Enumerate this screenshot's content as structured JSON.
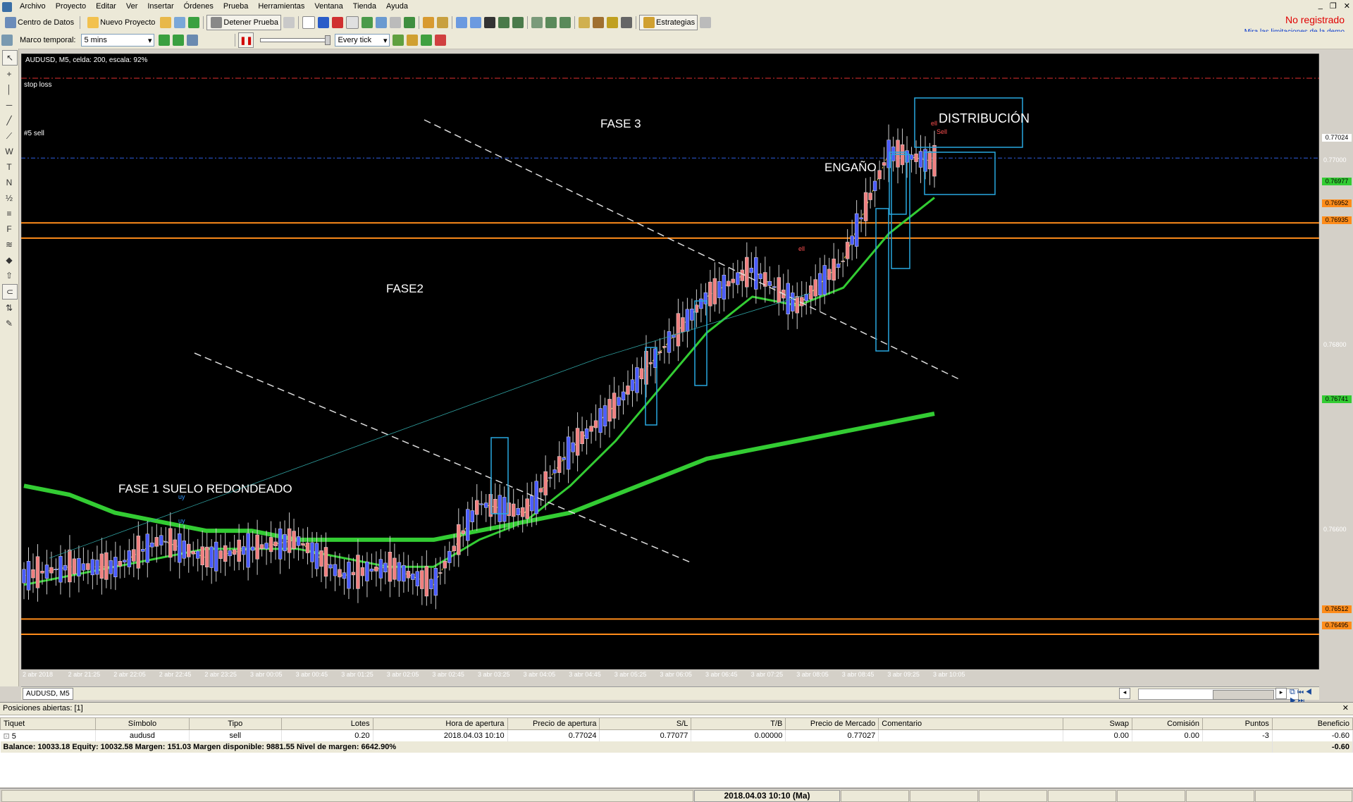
{
  "menu": [
    "Archivo",
    "Proyecto",
    "Editar",
    "Ver",
    "Insertar",
    "Órdenes",
    "Prueba",
    "Herramientas",
    "Ventana",
    "Tienda",
    "Ayuda"
  ],
  "toolbar": {
    "data_center": "Centro de Datos",
    "new_project": "Nuevo Proyecto",
    "stop_test": "Detener Prueba",
    "strategies": "Estrategias",
    "not_registered": "No registrado",
    "demo_limits": "Mira las limitaciones de la demo",
    "timeframe_label": "Marco temporal:",
    "timeframe_value": "5 mins",
    "tick_mode": "Every tick"
  },
  "chart": {
    "header": "AUDUSD, M5, celda: 200, escala: 92%",
    "stop_loss_label": "stop loss",
    "sell_line_label": "#5 sell",
    "annotations": {
      "fase1": "FASE 1 SUELO REDONDEADO",
      "fase2": "FASE2",
      "fase3": "FASE 3",
      "engano": "ENGAÑO",
      "distribucion": "DISTRIBUCIÓN"
    },
    "trade_labels": {
      "buy1": "uy",
      "buy2": "uy",
      "sell1": "ell",
      "sell2": "ell",
      "sell3": "Sell"
    },
    "price_ticks": [
      "0.77000",
      "0.76800",
      "0.76600"
    ],
    "price_badges": {
      "current": "0.77024",
      "ema_fast": "0.76977",
      "orange1": "0.76952",
      "orange2": "0.76935",
      "ema_slow": "0.76741",
      "orange3": "0.76512",
      "orange4": "0.76495"
    },
    "time_ticks": [
      "2 abr 2018",
      "2 abr 21:25",
      "2 abr 22:05",
      "2 abr 22:45",
      "2 abr 23:25",
      "3 abr 00:05",
      "3 abr 00:45",
      "3 abr 01:25",
      "3 abr 02:05",
      "3 abr 02:45",
      "3 abr 03:25",
      "3 abr 04:05",
      "3 abr 04:45",
      "3 abr 05:25",
      "3 abr 06:05",
      "3 abr 06:45",
      "3 abr 07:25",
      "3 abr 08:05",
      "3 abr 08:45",
      "3 abr 09:25",
      "3 abr 10:05"
    ],
    "tab": "AUDUSD, M5",
    "colors": {
      "bull": "#4a5cff",
      "bear": "#f08080",
      "orange": "#ff8c1a",
      "green": "#33cc33",
      "cyan": "#29a8e0",
      "stoploss": "#e03030",
      "sell": "#3060e0"
    }
  },
  "chart_data": {
    "type": "candlestick",
    "title": "AUDUSD, M5",
    "ylim": [
      0.7647,
      0.7714
    ],
    "levels": [
      0.76952,
      0.76935,
      0.76512,
      0.76495
    ],
    "current_price": 0.77024,
    "x": [
      "2 abr 2018",
      "2 abr 21:25",
      "2 abr 22:05",
      "2 abr 22:45",
      "2 abr 23:25",
      "3 abr 00:05",
      "3 abr 00:45",
      "3 abr 01:25",
      "3 abr 02:05",
      "3 abr 02:45",
      "3 abr 03:25",
      "3 abr 04:05",
      "3 abr 04:45",
      "3 abr 05:25",
      "3 abr 06:05",
      "3 abr 06:45",
      "3 abr 07:25",
      "3 abr 08:05",
      "3 abr 08:45",
      "3 abr 09:25",
      "3 abr 10:05"
    ],
    "series": [
      {
        "values": [
          0.7656,
          0.7657,
          0.7657,
          0.766,
          0.7658,
          0.7659,
          0.766,
          0.7656,
          0.7657,
          0.7655,
          0.7664,
          0.7663,
          0.767,
          0.7675,
          0.7681,
          0.7687,
          0.769,
          0.7686,
          0.7691,
          0.7703,
          0.7702
        ]
      },
      {
        "values": [
          0.7655,
          0.7656,
          0.7657,
          0.7658,
          0.7659,
          0.7659,
          0.7659,
          0.7658,
          0.7657,
          0.7657,
          0.766,
          0.7662,
          0.7666,
          0.7671,
          0.7677,
          0.7683,
          0.7687,
          0.7686,
          0.7688,
          0.7694,
          0.7698
        ]
      },
      {
        "values": [
          0.7666,
          0.7665,
          0.7663,
          0.7662,
          0.7661,
          0.7661,
          0.766,
          0.766,
          0.766,
          0.766,
          0.7661,
          0.7662,
          0.7663,
          0.7665,
          0.7667,
          0.7669,
          0.767,
          0.7671,
          0.7672,
          0.7673,
          0.7674
        ]
      }
    ]
  },
  "positions": {
    "title": "Posiciones abiertas: [1]",
    "columns": [
      "Tiquet",
      "Símbolo",
      "Tipo",
      "Lotes",
      "Hora de apertura",
      "Precio de apertura",
      "S/L",
      "T/B",
      "Precio de Mercado",
      "Comentario",
      "Swap",
      "Comisión",
      "Puntos",
      "Beneficio"
    ],
    "rows": [
      {
        "ticket": "5",
        "symbol": "audusd",
        "type": "sell",
        "lots": "0.20",
        "open_time": "2018.04.03 10:10",
        "open_price": "0.77024",
        "sl": "0.77077",
        "tp": "0.00000",
        "market": "0.77027",
        "comment": "",
        "swap": "0.00",
        "commission": "0.00",
        "points": "-3",
        "profit": "-0.60"
      }
    ],
    "balance": "Balance: 10033.18 Equity: 10032.58 Margen: 151.03 Margen disponible: 9881.55 Nivel de margen: 6642.90%",
    "balance_profit": "-0.60"
  },
  "status": {
    "datetime": "2018.04.03 10:10 (Ma)"
  }
}
